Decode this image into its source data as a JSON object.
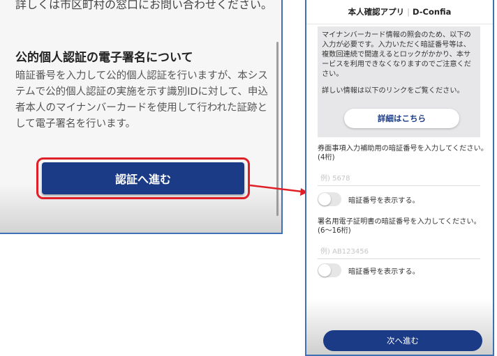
{
  "left": {
    "top_text": "詳しくは市区町村の窓口にお問い合わせください。",
    "section_title": "公的個人認証の電子署名について",
    "section_body": "暗証番号を入力して公的個人認証を行いますが、本システムで公的個人認証の実施を示す識別IDに対して、申込者本人のマイナンバーカードを使用して行われた証跡として電子署名を行います。",
    "auth_button_label": "認証へ進む"
  },
  "right": {
    "header_app": "本人確認アプリ",
    "header_sep": "|",
    "header_brand": "D-Confia",
    "info_text": "マイナンバーカード情報の照会のため、以下の入力が必要です。入力いただく暗証番号等は、複数回連続で間違えるとロックがかかり、本サービスを利用できなくなりますのでご注意ください。",
    "info_link_text": "詳しい情報は以下のリンクをご覧ください。",
    "details_button_label": "詳細はこちら",
    "pin1_label": "券面事項入力補助用の暗証番号を入力してください。(4桁)",
    "pin1_placeholder": "例) 5678",
    "pin1_show_label": "暗証番号を表示する。",
    "pin2_label": "署名用電子証明書の暗証番号を入力してください。(6〜16桁)",
    "pin2_placeholder": "例) AB123456",
    "pin2_show_label": "暗証番号を表示する。",
    "next_button_label": "次へ進む"
  },
  "colors": {
    "primary": "#1b3b86",
    "highlight": "#e01f26",
    "frame": "#3f6fb4"
  }
}
